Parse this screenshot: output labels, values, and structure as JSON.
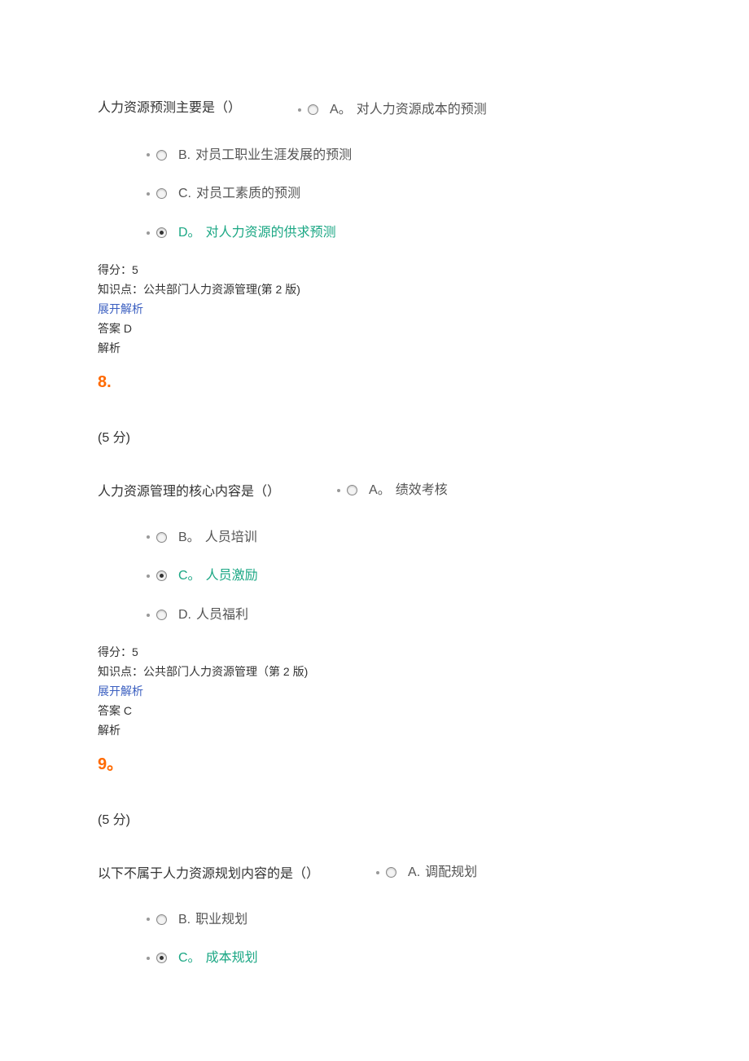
{
  "q7": {
    "question": "人力资源预测主要是（）",
    "options": {
      "a": {
        "label": "A。",
        "text": "对人力资源成本的预测",
        "selected": false,
        "correct": false
      },
      "b": {
        "label": "B.",
        "text": "对员工职业生涯发展的预测",
        "selected": false,
        "correct": false
      },
      "c": {
        "label": "C.",
        "text": "对员工素质的预测",
        "selected": false,
        "correct": false
      },
      "d": {
        "label": "D。",
        "text": "对人力资源的供求预测",
        "selected": true,
        "correct": true
      }
    },
    "score": "得分：5",
    "knowledge": "知识点：公共部门人力资源管理(第 2 版)",
    "expand": "展开解析",
    "answer": "答案 D",
    "analysis": "解析"
  },
  "q8": {
    "number": "8.",
    "points": "(5 分)",
    "question": "人力资源管理的核心内容是（）",
    "options": {
      "a": {
        "label": "A。",
        "text": "绩效考核",
        "selected": false,
        "correct": false
      },
      "b": {
        "label": "B。",
        "text": "人员培训",
        "selected": false,
        "correct": false
      },
      "c": {
        "label": "C。",
        "text": "人员激励",
        "selected": true,
        "correct": true
      },
      "d": {
        "label": "D.",
        "text": "人员福利",
        "selected": false,
        "correct": false
      }
    },
    "score": "得分：5",
    "knowledge": "知识点：公共部门人力资源管理（第 2 版)",
    "expand": "展开解析",
    "answer": "答案 C",
    "analysis": "解析"
  },
  "q9": {
    "number": "9。",
    "points": "(5 分)",
    "question": "以下不属于人力资源规划内容的是（）",
    "options": {
      "a": {
        "label": "A.",
        "text": "调配规划",
        "selected": false,
        "correct": false
      },
      "b": {
        "label": "B.",
        "text": "职业规划",
        "selected": false,
        "correct": false
      },
      "c": {
        "label": "C。",
        "text": "成本规划",
        "selected": true,
        "correct": true
      }
    }
  }
}
